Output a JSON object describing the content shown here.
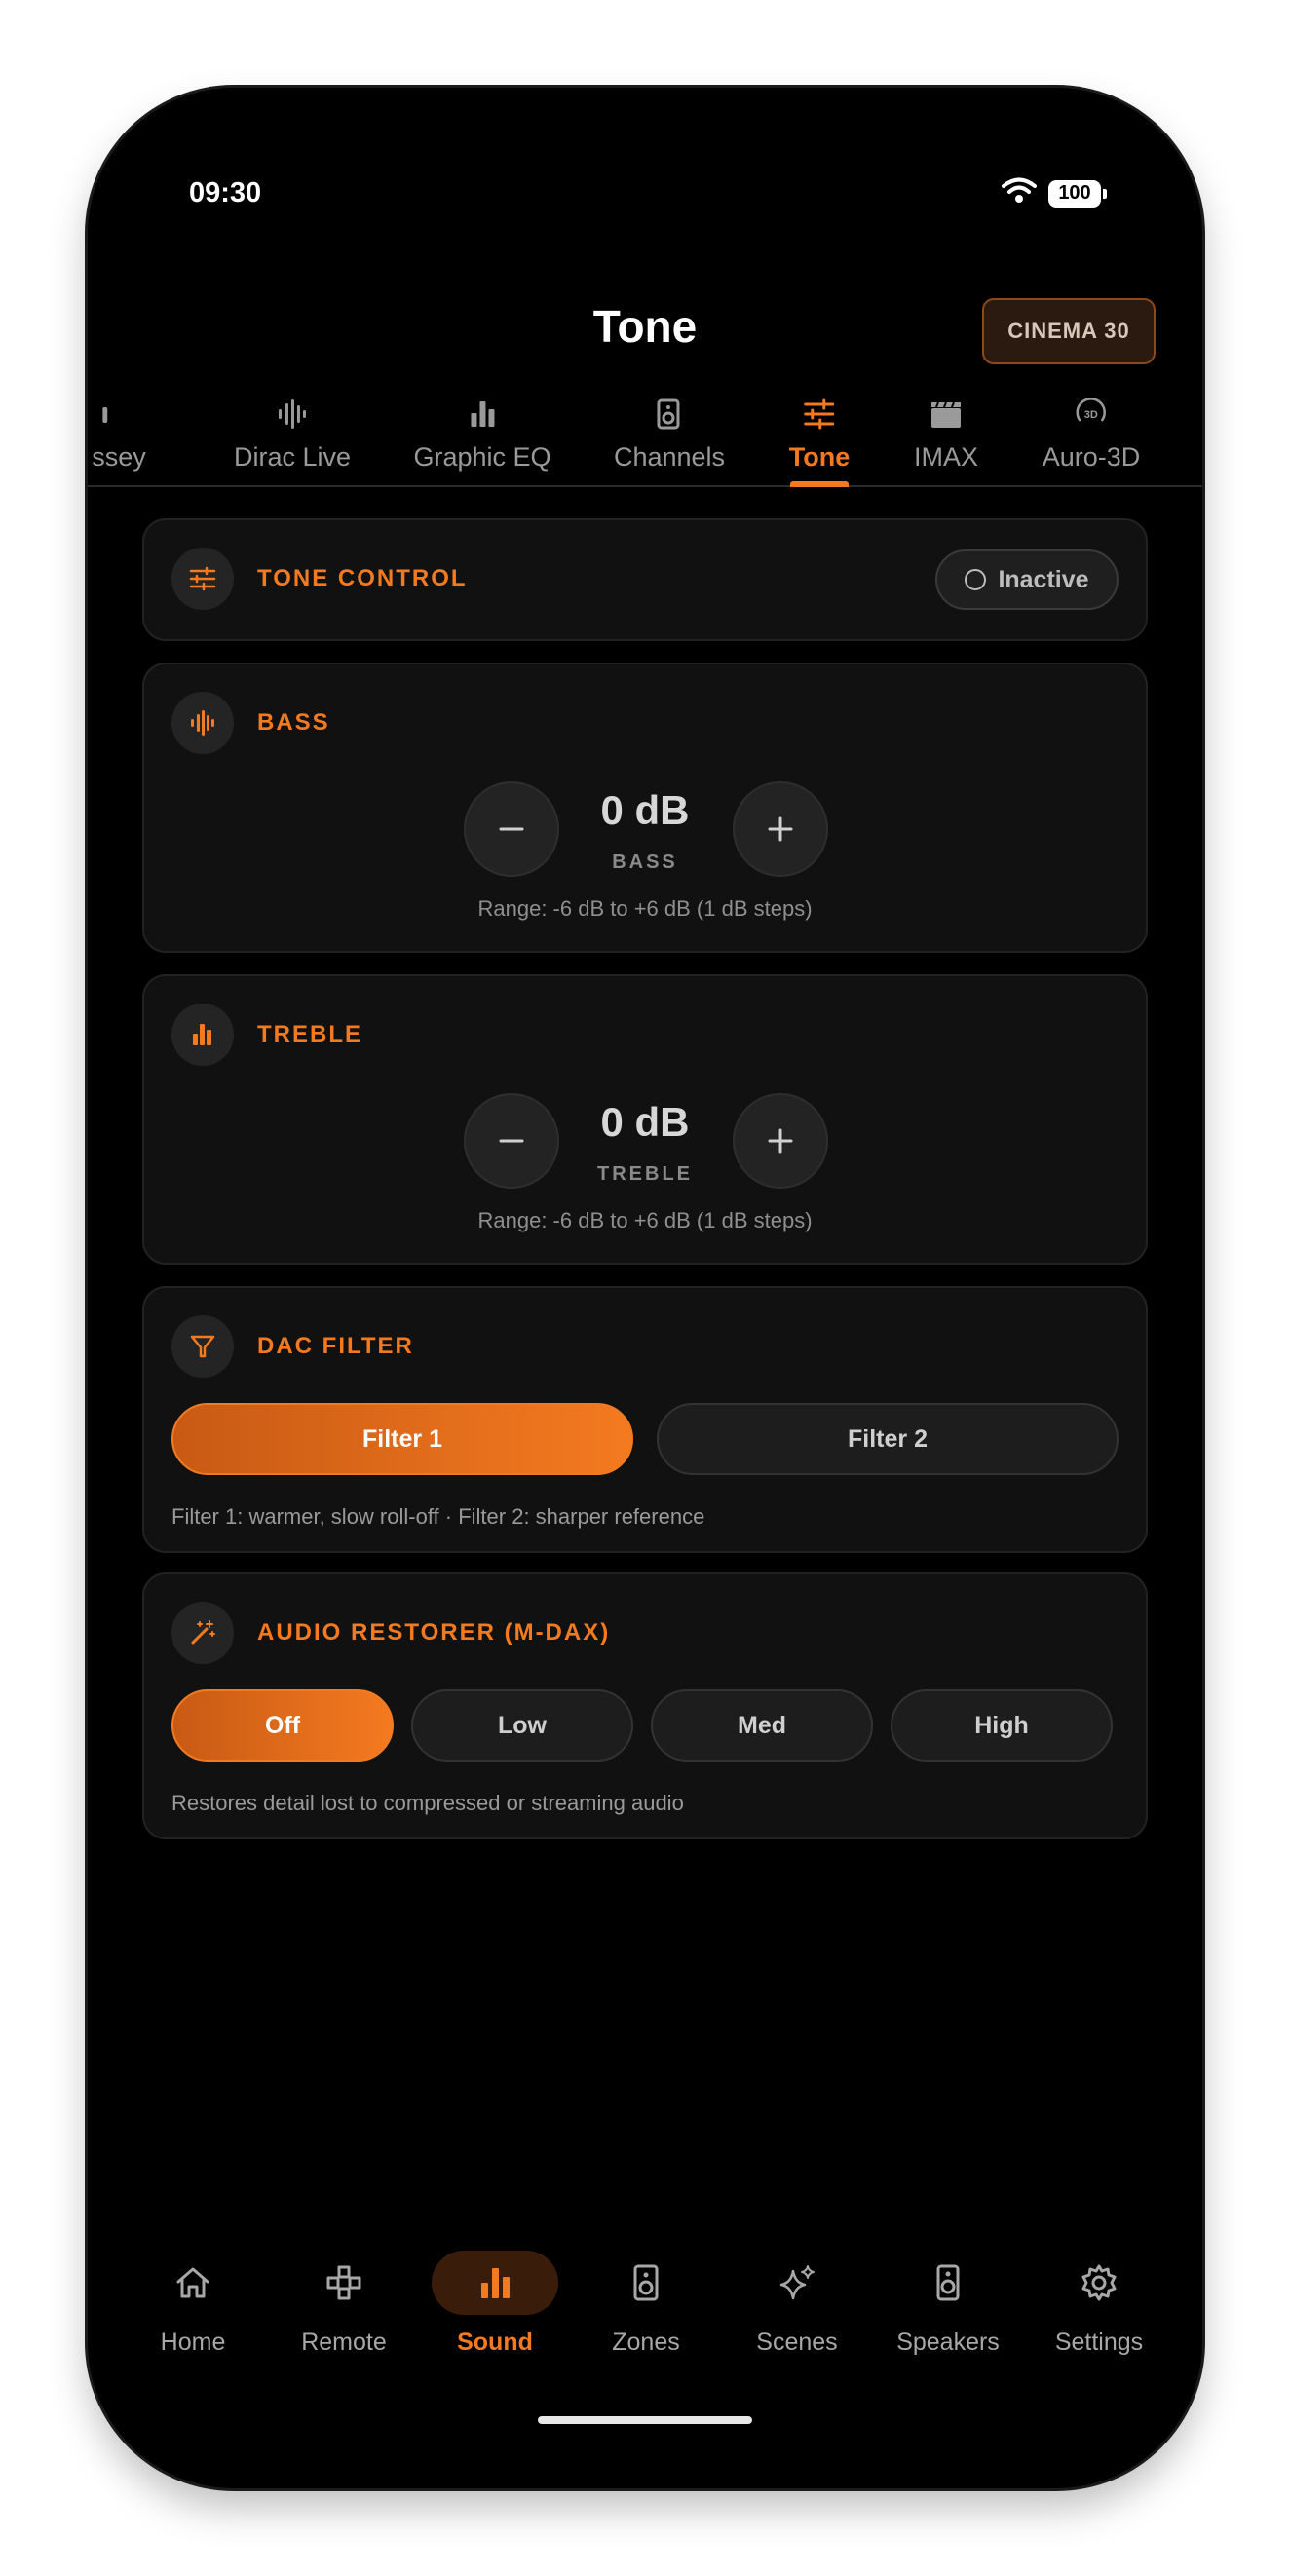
{
  "status_bar": {
    "time": "09:30",
    "battery": "100"
  },
  "header": {
    "title": "Tone",
    "preset": "CINEMA 30"
  },
  "tabs": [
    {
      "label": "ssey",
      "icon": "bar-icon"
    },
    {
      "label": "Dirac Live",
      "icon": "waveform-icon"
    },
    {
      "label": "Graphic EQ",
      "icon": "bar-chart-icon"
    },
    {
      "label": "Channels",
      "icon": "speaker-icon"
    },
    {
      "label": "Tone",
      "icon": "sliders-icon",
      "active": true
    },
    {
      "label": "IMAX",
      "icon": "clapperboard-icon"
    },
    {
      "label": "Auro-3D",
      "icon": "3d-rotate-icon"
    }
  ],
  "tone_control": {
    "title": "TONE CONTROL",
    "status": "Inactive"
  },
  "bass": {
    "title": "BASS",
    "value": "0 dB",
    "sub": "BASS",
    "range": "Range: -6 dB to +6 dB (1 dB steps)"
  },
  "treble": {
    "title": "TREBLE",
    "value": "0 dB",
    "sub": "TREBLE",
    "range": "Range: -6 dB to +6 dB (1 dB steps)"
  },
  "dac_filter": {
    "title": "DAC FILTER",
    "options": [
      "Filter 1",
      "Filter 2"
    ],
    "selected": "Filter 1",
    "hint": "Filter 1: warmer, slow roll-off · Filter 2: sharper reference"
  },
  "audio_restorer": {
    "title": "AUDIO RESTORER (M-DAX)",
    "options": [
      "Off",
      "Low",
      "Med",
      "High"
    ],
    "selected": "Off",
    "hint": "Restores detail lost to compressed or streaming audio"
  },
  "bottom_nav": [
    {
      "label": "Home",
      "icon": "home-icon"
    },
    {
      "label": "Remote",
      "icon": "gamepad-icon"
    },
    {
      "label": "Sound",
      "icon": "bar-chart-icon",
      "active": true
    },
    {
      "label": "Zones",
      "icon": "speakers-icon"
    },
    {
      "label": "Scenes",
      "icon": "sparkles-icon"
    },
    {
      "label": "Speakers",
      "icon": "speaker-icon"
    },
    {
      "label": "Settings",
      "icon": "gear-icon"
    }
  ],
  "colors": {
    "accent": "#f47a20",
    "background": "#000000",
    "card": "#111111"
  }
}
